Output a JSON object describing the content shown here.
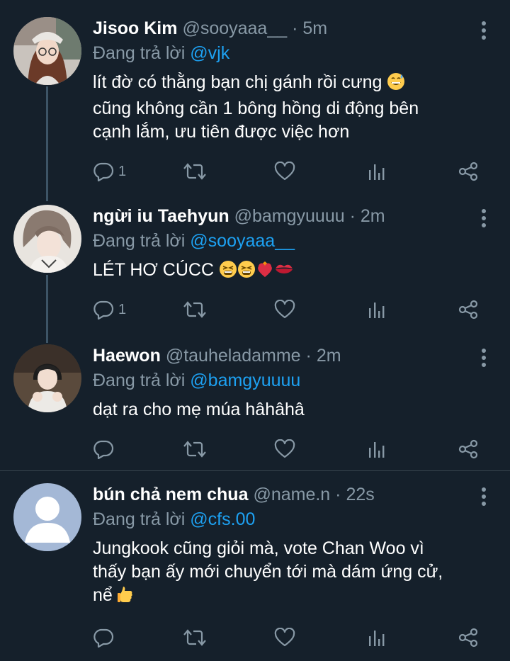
{
  "tweets": [
    {
      "name": "Jisoo Kim",
      "handle": "@sooyaaa__",
      "time": "5m",
      "reply_prefix": "Đang trả lời",
      "reply_to": "@vjk",
      "text_lines": [
        "lít đờ có thằng bạn chị gánh rồi cưng",
        "cũng không cần 1 bông hồng di động bên",
        "cạnh lắm, ưu tiên được việc hơn"
      ],
      "reply_count": "1"
    },
    {
      "name": "ngừi iu Taehyun",
      "handle": "@bamgyuuuu",
      "time": "2m",
      "reply_prefix": "Đang trả lời",
      "reply_to": "@sooyaaa__",
      "text_lines": [
        "LÉT HƠ CÚCC"
      ],
      "reply_count": "1"
    },
    {
      "name": "Haewon",
      "handle": "@tauheladamme",
      "time": "2m",
      "reply_prefix": "Đang trả lời",
      "reply_to": "@bamgyuuuu",
      "text_lines": [
        "dạt ra cho mẹ múa hâhâhâ"
      ],
      "reply_count": ""
    },
    {
      "name": "bún chả nem chua",
      "handle": "@name.n",
      "time": "22s",
      "reply_prefix": "Đang trả lời",
      "reply_to": "@cfs.00",
      "text_lines": [
        "Jungkook cũng giỏi mà, vote Chan Woo vì",
        "thấy bạn ấy mới chuyển tới mà dám ứng cử,",
        "nể"
      ],
      "reply_count": ""
    }
  ],
  "separator": "·",
  "icons": [
    "reply-icon",
    "retweet-icon",
    "like-icon",
    "analytics-icon",
    "share-icon",
    "more-icon"
  ],
  "colors": {
    "background": "#15202b",
    "secondary_text": "#8899a6",
    "link": "#1da1f2",
    "thread_line": "#3d5466"
  }
}
